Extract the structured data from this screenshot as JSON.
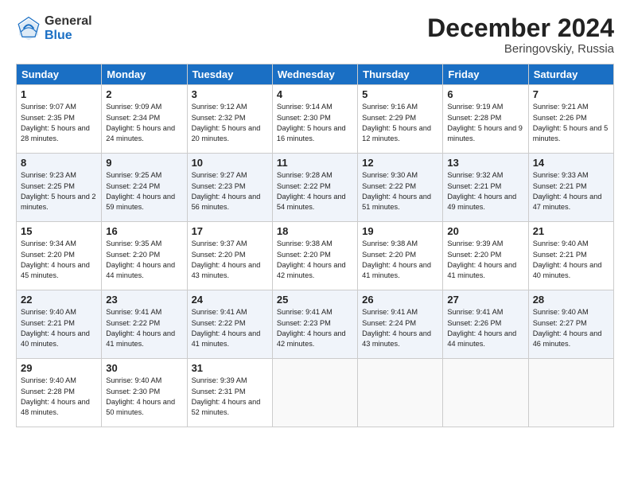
{
  "header": {
    "logo_general": "General",
    "logo_blue": "Blue",
    "month_title": "December 2024",
    "location": "Beringovskiy, Russia"
  },
  "days_of_week": [
    "Sunday",
    "Monday",
    "Tuesday",
    "Wednesday",
    "Thursday",
    "Friday",
    "Saturday"
  ],
  "weeks": [
    [
      {
        "day": 1,
        "sunrise": "9:07 AM",
        "sunset": "2:35 PM",
        "daylight": "5 hours and 28 minutes."
      },
      {
        "day": 2,
        "sunrise": "9:09 AM",
        "sunset": "2:34 PM",
        "daylight": "5 hours and 24 minutes."
      },
      {
        "day": 3,
        "sunrise": "9:12 AM",
        "sunset": "2:32 PM",
        "daylight": "5 hours and 20 minutes."
      },
      {
        "day": 4,
        "sunrise": "9:14 AM",
        "sunset": "2:30 PM",
        "daylight": "5 hours and 16 minutes."
      },
      {
        "day": 5,
        "sunrise": "9:16 AM",
        "sunset": "2:29 PM",
        "daylight": "5 hours and 12 minutes."
      },
      {
        "day": 6,
        "sunrise": "9:19 AM",
        "sunset": "2:28 PM",
        "daylight": "5 hours and 9 minutes."
      },
      {
        "day": 7,
        "sunrise": "9:21 AM",
        "sunset": "2:26 PM",
        "daylight": "5 hours and 5 minutes."
      }
    ],
    [
      {
        "day": 8,
        "sunrise": "9:23 AM",
        "sunset": "2:25 PM",
        "daylight": "5 hours and 2 minutes."
      },
      {
        "day": 9,
        "sunrise": "9:25 AM",
        "sunset": "2:24 PM",
        "daylight": "4 hours and 59 minutes."
      },
      {
        "day": 10,
        "sunrise": "9:27 AM",
        "sunset": "2:23 PM",
        "daylight": "4 hours and 56 minutes."
      },
      {
        "day": 11,
        "sunrise": "9:28 AM",
        "sunset": "2:22 PM",
        "daylight": "4 hours and 54 minutes."
      },
      {
        "day": 12,
        "sunrise": "9:30 AM",
        "sunset": "2:22 PM",
        "daylight": "4 hours and 51 minutes."
      },
      {
        "day": 13,
        "sunrise": "9:32 AM",
        "sunset": "2:21 PM",
        "daylight": "4 hours and 49 minutes."
      },
      {
        "day": 14,
        "sunrise": "9:33 AM",
        "sunset": "2:21 PM",
        "daylight": "4 hours and 47 minutes."
      }
    ],
    [
      {
        "day": 15,
        "sunrise": "9:34 AM",
        "sunset": "2:20 PM",
        "daylight": "4 hours and 45 minutes."
      },
      {
        "day": 16,
        "sunrise": "9:35 AM",
        "sunset": "2:20 PM",
        "daylight": "4 hours and 44 minutes."
      },
      {
        "day": 17,
        "sunrise": "9:37 AM",
        "sunset": "2:20 PM",
        "daylight": "4 hours and 43 minutes."
      },
      {
        "day": 18,
        "sunrise": "9:38 AM",
        "sunset": "2:20 PM",
        "daylight": "4 hours and 42 minutes."
      },
      {
        "day": 19,
        "sunrise": "9:38 AM",
        "sunset": "2:20 PM",
        "daylight": "4 hours and 41 minutes."
      },
      {
        "day": 20,
        "sunrise": "9:39 AM",
        "sunset": "2:20 PM",
        "daylight": "4 hours and 41 minutes."
      },
      {
        "day": 21,
        "sunrise": "9:40 AM",
        "sunset": "2:21 PM",
        "daylight": "4 hours and 40 minutes."
      }
    ],
    [
      {
        "day": 22,
        "sunrise": "9:40 AM",
        "sunset": "2:21 PM",
        "daylight": "4 hours and 40 minutes."
      },
      {
        "day": 23,
        "sunrise": "9:41 AM",
        "sunset": "2:22 PM",
        "daylight": "4 hours and 41 minutes."
      },
      {
        "day": 24,
        "sunrise": "9:41 AM",
        "sunset": "2:22 PM",
        "daylight": "4 hours and 41 minutes."
      },
      {
        "day": 25,
        "sunrise": "9:41 AM",
        "sunset": "2:23 PM",
        "daylight": "4 hours and 42 minutes."
      },
      {
        "day": 26,
        "sunrise": "9:41 AM",
        "sunset": "2:24 PM",
        "daylight": "4 hours and 43 minutes."
      },
      {
        "day": 27,
        "sunrise": "9:41 AM",
        "sunset": "2:26 PM",
        "daylight": "4 hours and 44 minutes."
      },
      {
        "day": 28,
        "sunrise": "9:40 AM",
        "sunset": "2:27 PM",
        "daylight": "4 hours and 46 minutes."
      }
    ],
    [
      {
        "day": 29,
        "sunrise": "9:40 AM",
        "sunset": "2:28 PM",
        "daylight": "4 hours and 48 minutes."
      },
      {
        "day": 30,
        "sunrise": "9:40 AM",
        "sunset": "2:30 PM",
        "daylight": "4 hours and 50 minutes."
      },
      {
        "day": 31,
        "sunrise": "9:39 AM",
        "sunset": "2:31 PM",
        "daylight": "4 hours and 52 minutes."
      },
      null,
      null,
      null,
      null
    ]
  ]
}
